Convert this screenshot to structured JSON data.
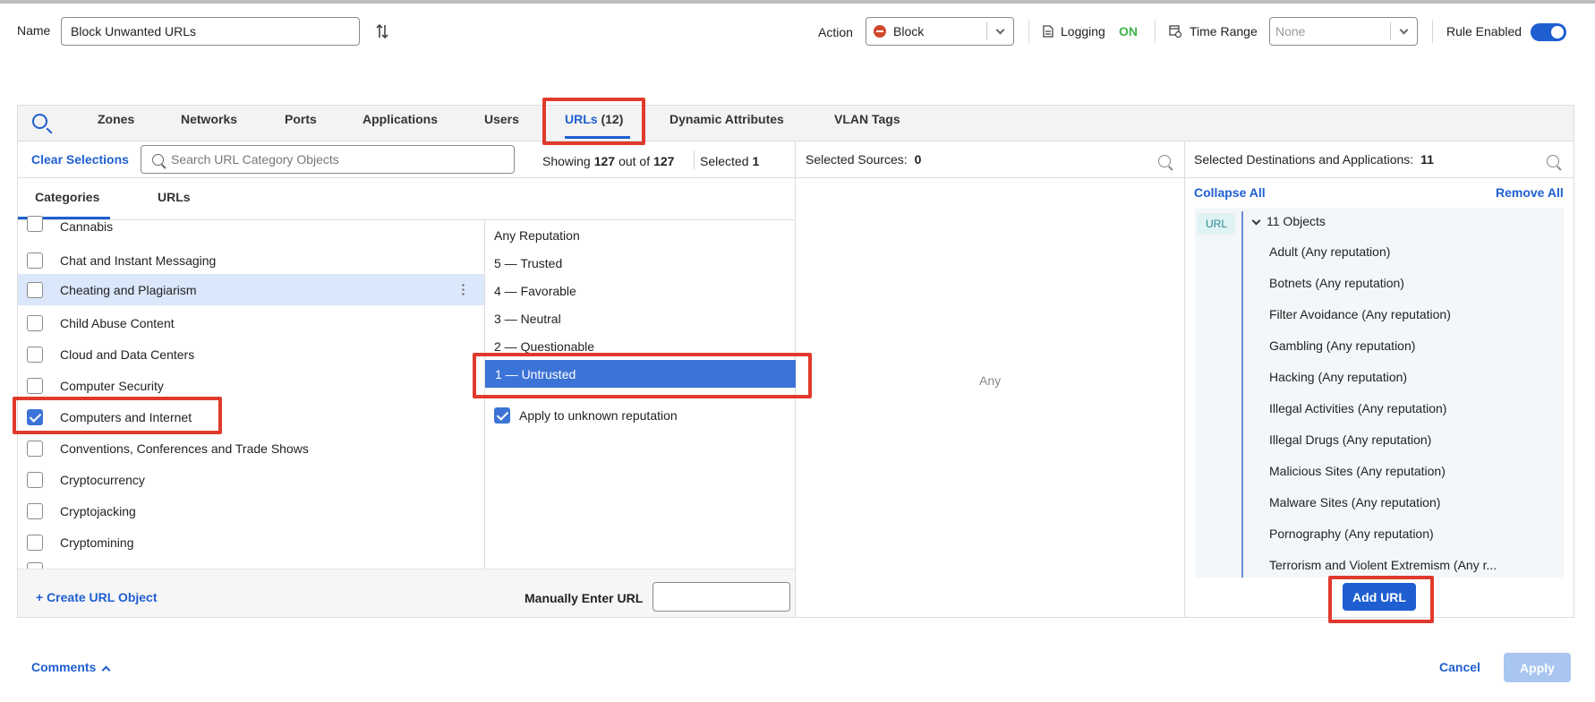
{
  "header": {
    "name_label": "Name",
    "name_value": "Block Unwanted URLs",
    "action_label": "Action",
    "action_value": "Block",
    "logging_label": "Logging",
    "logging_status": "ON",
    "time_range_label": "Time Range",
    "time_range_value": "None",
    "rule_enabled_label": "Rule Enabled",
    "rule_enabled": true
  },
  "colors": {
    "accent": "#1f5ed1",
    "logging_on": "#3bb54a",
    "block": "#d0482b",
    "highlight": "#e03a2c"
  },
  "tabs": [
    {
      "label": "Zones"
    },
    {
      "label": "Networks"
    },
    {
      "label": "Ports"
    },
    {
      "label": "Applications"
    },
    {
      "label": "Users"
    },
    {
      "label": "URLs",
      "count": "(12)",
      "active": true
    },
    {
      "label": "Dynamic Attributes"
    },
    {
      "label": "VLAN Tags"
    }
  ],
  "left": {
    "clear_selections": "Clear Selections",
    "search_placeholder": "Search URL Category Objects",
    "showing_prefix": "Showing",
    "showing_count": "127",
    "showing_mid": "out of",
    "showing_total": "127",
    "selected_label": "Selected",
    "selected_count": "1",
    "subtabs": [
      "Categories",
      "URLs"
    ],
    "categories": [
      {
        "label": "Cannabis",
        "checked": false
      },
      {
        "label": "Chat and Instant Messaging",
        "checked": false
      },
      {
        "label": "Cheating and Plagiarism",
        "checked": false,
        "highlighted": true
      },
      {
        "label": "Child Abuse Content",
        "checked": false
      },
      {
        "label": "Cloud and Data Centers",
        "checked": false
      },
      {
        "label": "Computer Security",
        "checked": false
      },
      {
        "label": "Computers and Internet",
        "checked": true
      },
      {
        "label": "Conventions, Conferences and Trade Shows",
        "checked": false
      },
      {
        "label": "Cryptocurrency",
        "checked": false
      },
      {
        "label": "Cryptojacking",
        "checked": false
      },
      {
        "label": "Cryptomining",
        "checked": false
      }
    ],
    "reputations": [
      "Any Reputation",
      "5 — Trusted",
      "4 — Favorable",
      "3 — Neutral",
      "2 — Questionable",
      "1 — Untrusted"
    ],
    "selected_reputation": "1 — Untrusted",
    "apply_unknown_label": "Apply to unknown reputation",
    "apply_unknown_checked": true,
    "create_url_object": "+ Create URL Object",
    "manual_url_label": "Manually Enter URL"
  },
  "sources": {
    "label": "Selected Sources:",
    "count": "0",
    "placeholder": "Any"
  },
  "destinations": {
    "label": "Selected Destinations and Applications:",
    "count": "11",
    "collapse_all": "Collapse All",
    "remove_all": "Remove All",
    "badge": "URL",
    "group_label": "11 Objects",
    "objects": [
      "Adult (Any reputation)",
      "Botnets (Any reputation)",
      "Filter Avoidance (Any reputation)",
      "Gambling (Any reputation)",
      "Hacking (Any reputation)",
      "Illegal Activities (Any reputation)",
      "Illegal Drugs (Any reputation)",
      "Malicious Sites (Any reputation)",
      "Malware Sites (Any reputation)",
      "Pornography (Any reputation)",
      "Terrorism and Violent Extremism (Any r..."
    ],
    "add_url": "Add URL"
  },
  "footer": {
    "comments": "Comments",
    "cancel": "Cancel",
    "apply": "Apply"
  }
}
